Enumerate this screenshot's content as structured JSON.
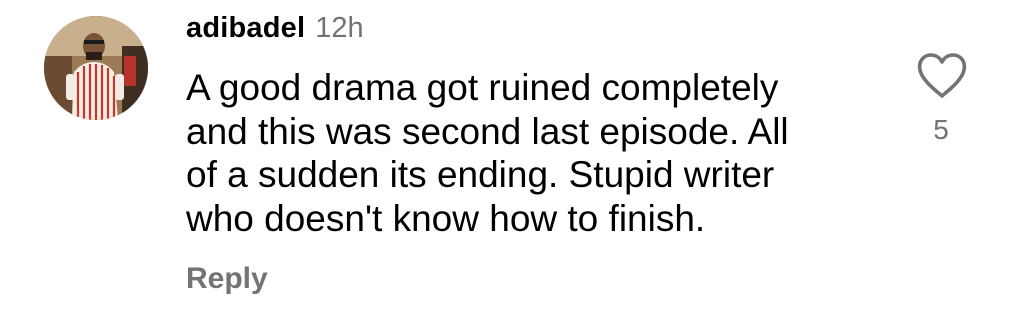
{
  "comment": {
    "username": "adibadel",
    "timestamp": "12h",
    "text_lines": [
      "A good drama got ruined completely",
      "and this was second last episode. All",
      "of a sudden its ending. Stupid writer",
      "who doesn't know how to finish."
    ],
    "reply_label": "Reply",
    "like_count": "5",
    "like_icon": "heart-outline-icon",
    "colors": {
      "text": "#000000",
      "secondary": "#737373",
      "background": "#ffffff"
    }
  }
}
